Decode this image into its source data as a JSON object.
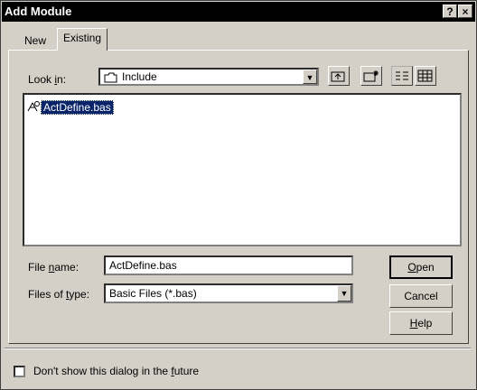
{
  "window": {
    "title": "Add Module",
    "help_glyph": "?",
    "close_glyph": "×"
  },
  "tabs": {
    "new": "New",
    "existing": "Existing"
  },
  "look_in": {
    "label_pre": "Look ",
    "label_key": "i",
    "label_post": "n:",
    "value": "Include"
  },
  "toolbar": {
    "up_icon": "up-one-level-icon",
    "new_folder_icon": "new-folder-icon",
    "list_icon": "list-view-icon",
    "details_icon": "details-view-icon"
  },
  "files": [
    {
      "name": "ActDefine.bas",
      "icon": "module-file-icon",
      "selected": true
    }
  ],
  "file_name": {
    "label_pre": "File ",
    "label_key": "n",
    "label_post": "ame:",
    "value": "ActDefine.bas"
  },
  "file_type": {
    "label_pre": "Files of ",
    "label_key": "t",
    "label_post": "ype:",
    "value": "Basic Files (*.bas)"
  },
  "buttons": {
    "open_key": "O",
    "open_rest": "pen",
    "cancel": "Cancel",
    "help_key": "H",
    "help_rest": "elp"
  },
  "footer": {
    "pre": "Don't show this dialog in the ",
    "key": "f",
    "post": "uture",
    "checked": false
  },
  "colors": {
    "titlebar": "#000000",
    "dialog": "#d4d0c8",
    "selection": "#0a246a"
  }
}
